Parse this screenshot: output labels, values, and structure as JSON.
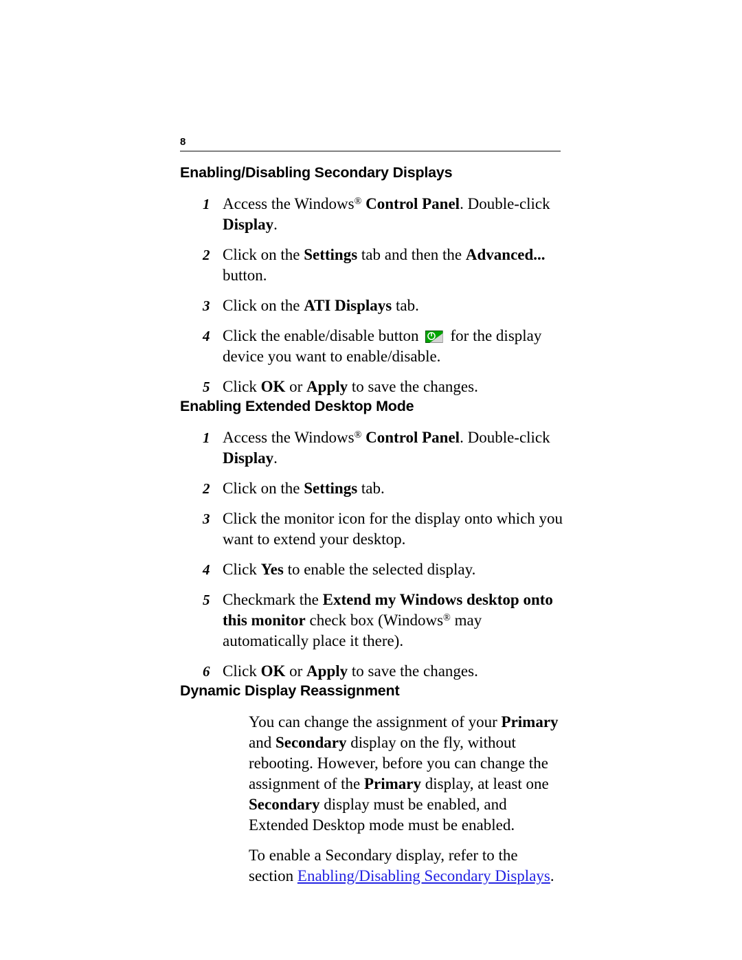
{
  "page": {
    "folio": "8"
  },
  "sections": [
    {
      "id": "enabling-disabling-secondary-displays",
      "title": "Enabling/Disabling Secondary Displays",
      "steps": [
        {
          "num": "1"
        },
        {
          "num": "2"
        },
        {
          "num": "3"
        },
        {
          "num": "4"
        },
        {
          "num": "5"
        }
      ]
    },
    {
      "id": "enabling-extended-desktop-mode",
      "title": "Enabling Extended Desktop Mode",
      "steps": [
        {
          "num": "1"
        },
        {
          "num": "2"
        },
        {
          "num": "3"
        },
        {
          "num": "4"
        },
        {
          "num": "5"
        },
        {
          "num": "6"
        }
      ]
    },
    {
      "id": "dynamic-display-reassignment",
      "title": "Dynamic Display Reassignment"
    }
  ],
  "s1_steps": {
    "n1": "1",
    "t1_a": "Access the Windows",
    "t1_reg": "®",
    "t1_b": "Control Panel",
    "t1_c": ". Double-click ",
    "t1_d": "Display",
    "t1_e": ".",
    "n2": "2",
    "t2_a": "Click on the ",
    "t2_b": "Settings",
    "t2_c": " tab and then the ",
    "t2_d": "Advanced...",
    "t2_e": " button.",
    "n3": "3",
    "t3_a": "Click on the ",
    "t3_b": "ATI Displays",
    "t3_c": " tab.",
    "n4": "4",
    "t4_a": "Click the enable/disable button",
    "t4_icon": "enable-disable-button-icon",
    "t4_b": "for the display device you want to enable/disable.",
    "n5": "5",
    "t5_a": "Click ",
    "t5_b": "OK",
    "t5_c": " or ",
    "t5_d": "Apply",
    "t5_e": " to save the changes."
  },
  "s2_steps": {
    "n1": "1",
    "t1_a": "Access the Windows",
    "t1_reg": "®",
    "t1_b": "Control Panel",
    "t1_c": ". Double-click ",
    "t1_d": "Display",
    "t1_e": ".",
    "n2": "2",
    "t2_a": "Click on the ",
    "t2_b": "Settings",
    "t2_c": " tab.",
    "n3": "3",
    "t3_a": "Click the monitor icon for the display onto which you want to extend your desktop.",
    "n4": "4",
    "t4_a": "Click ",
    "t4_b": "Yes",
    "t4_c": " to enable the selected display.",
    "n5": "5",
    "t5_a": "Checkmark the ",
    "t5_b": "Extend my Windows desktop onto this monitor",
    "t5_c": " check box (Windows",
    "t5_reg": "®",
    "t5_d": " may automatically place it there).",
    "n6": "6",
    "t6_a": "Click ",
    "t6_b": "OK",
    "t6_c": " or ",
    "t6_d": "Apply",
    "t6_e": " to save the changes."
  },
  "s3_body": {
    "p1_a": "You can change the assignment of your ",
    "p1_b": "Primary",
    "p1_c": " and ",
    "p1_d": "Secondary",
    "p1_e": " display on the fly, without rebooting. However, before you can change the assignment of the ",
    "p1_f": "Primary",
    "p1_g": " display, at least one ",
    "p1_h": "Secondary",
    "p1_i": " display must be enabled, and Extended Desktop mode must be enabled.",
    "p2_a": "To enable a Secondary display, refer to the section ",
    "p2_link": "Enabling/Disabling Secondary Displays",
    "p2_b": "."
  },
  "colors": {
    "text": "#000000",
    "link": "#2222E2",
    "rule": "#808080",
    "icon_green": "#00A400",
    "icon_gray": "#D4D4D4"
  }
}
